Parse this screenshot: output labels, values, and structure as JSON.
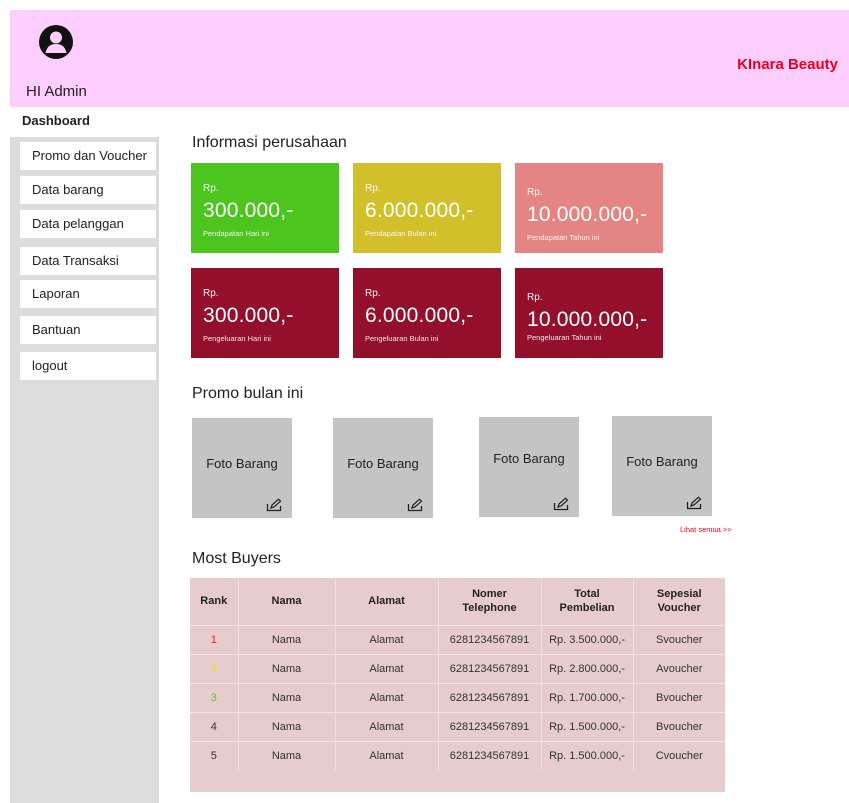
{
  "header": {
    "greeting": "HI Admin",
    "brand": "KInara Beauty",
    "avatar_icon": "user-avatar-icon"
  },
  "sidebar": {
    "items": [
      {
        "label": "Dashboard"
      },
      {
        "label": "Promo dan Voucher"
      },
      {
        "label": "Data barang"
      },
      {
        "label": "Data pelanggan"
      },
      {
        "label": "Data Transaksi"
      },
      {
        "label": "Laporan"
      },
      {
        "label": "Bantuan"
      },
      {
        "label": "logout"
      }
    ]
  },
  "info": {
    "title": "Informasi perusahaan",
    "cards": [
      {
        "rp": "Rp.",
        "amount": "300.000,-",
        "caption": "Pendapatan Hari ini",
        "color": "#4cc51f"
      },
      {
        "rp": "Rp.",
        "amount": "6.000.000,-",
        "caption": "Pendapatan Bulan ini",
        "color": "#d2c02a"
      },
      {
        "rp": "Rp.",
        "amount": "10.000.000,-",
        "caption": "Pendapatan Tahun ini",
        "color": "#e48483"
      },
      {
        "rp": "Rp.",
        "amount": "300.000,-",
        "caption": "Pengeluaran Hari ini",
        "color": "#940f2c"
      },
      {
        "rp": "Rp.",
        "amount": "6.000.000,-",
        "caption": "Pengeluaran Bulan ini",
        "color": "#940f2c"
      },
      {
        "rp": "Rp.",
        "amount": "10.000.000,-",
        "caption": "Pengeluaran Tahun ini",
        "color": "#940f2c"
      }
    ]
  },
  "promo": {
    "title": "Promo bulan ini",
    "items": [
      {
        "label": "Foto Barang"
      },
      {
        "label": "Foto Barang"
      },
      {
        "label": "Foto Barang"
      },
      {
        "label": "Foto Barang"
      }
    ],
    "edit_icon": "edit-icon",
    "see_all": "Lihat semua >>"
  },
  "buyers": {
    "title": "Most Buyers",
    "columns": [
      "Rank",
      "Nama",
      "Alamat",
      "Nomer Telephone",
      "Total Pembelian",
      "Sepesial Voucher"
    ],
    "rows": [
      {
        "rank": "1",
        "rank_color": "#ff1a1a",
        "nama": "Nama",
        "alamat": "Alamat",
        "phone": "6281234567891",
        "total": "Rp. 3.500.000,-",
        "voucher": "Svoucher"
      },
      {
        "rank": "2",
        "rank_color": "#f2e21d",
        "nama": "Nama",
        "alamat": "Alamat",
        "phone": "6281234567891",
        "total": "Rp. 2.800.000,-",
        "voucher": "Avoucher"
      },
      {
        "rank": "3",
        "rank_color": "#5fcf1e",
        "nama": "Nama",
        "alamat": "Alamat",
        "phone": "6281234567891",
        "total": "Rp. 1.700.000,-",
        "voucher": "Bvoucher"
      },
      {
        "rank": "4",
        "rank_color": "#333333",
        "nama": "Nama",
        "alamat": "Alamat",
        "phone": "6281234567891",
        "total": "Rp. 1.500.000,-",
        "voucher": "Bvoucher"
      },
      {
        "rank": "5",
        "rank_color": "#333333",
        "nama": "Nama",
        "alamat": "Alamat",
        "phone": "6281234567891",
        "total": "Rp. 1.500.000,-",
        "voucher": "Cvoucher"
      }
    ]
  }
}
